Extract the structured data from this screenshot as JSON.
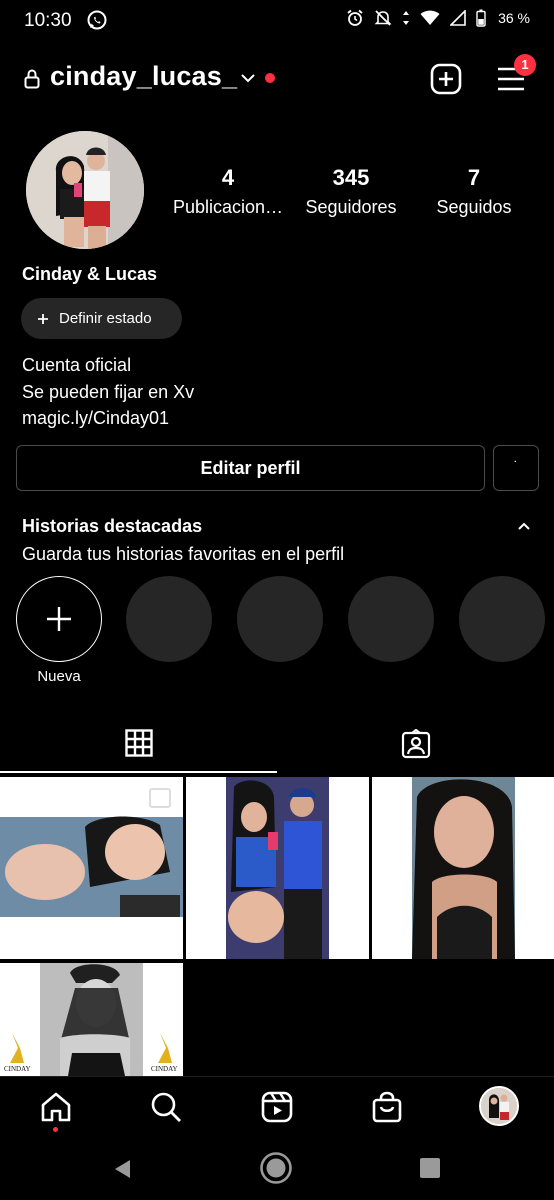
{
  "status_bar": {
    "time": "10:30",
    "battery": "36 %"
  },
  "header": {
    "username": "cinday_lucas_",
    "notification_count": "1"
  },
  "profile": {
    "stats": [
      {
        "value": "4",
        "label": "Publicacion…"
      },
      {
        "value": "345",
        "label": "Seguidores"
      },
      {
        "value": "7",
        "label": "Seguidos"
      }
    ],
    "display_name": "Cinday & Lucas",
    "status_button": "Definir estado",
    "bio": [
      "Cuenta oficial",
      "Se pueden fijar en Xv",
      "magic.ly/Cinday01"
    ]
  },
  "actions": {
    "edit_profile": "Editar perfil",
    "more": "˙"
  },
  "highlights": {
    "title": "Historias destacadas",
    "subtitle": "Guarda tus historias favoritas en el perfil",
    "new_label": "Nueva"
  },
  "posts": [
    {
      "kind": "photo"
    },
    {
      "kind": "photo"
    },
    {
      "kind": "photo"
    },
    {
      "kind": "photo"
    }
  ],
  "watermark": "CINDAY",
  "colors": {
    "background": "#000000",
    "accent_red": "#ff3040",
    "surface": "#262626",
    "border": "#4a4a4a"
  },
  "icons": {
    "header": [
      "lock-icon",
      "chevron-down-icon",
      "add-post-icon",
      "menu-icon"
    ],
    "tabs": [
      "grid-icon",
      "tagged-icon"
    ],
    "nav": [
      "home-icon",
      "search-icon",
      "reels-icon",
      "shop-icon",
      "profile-avatar"
    ]
  }
}
